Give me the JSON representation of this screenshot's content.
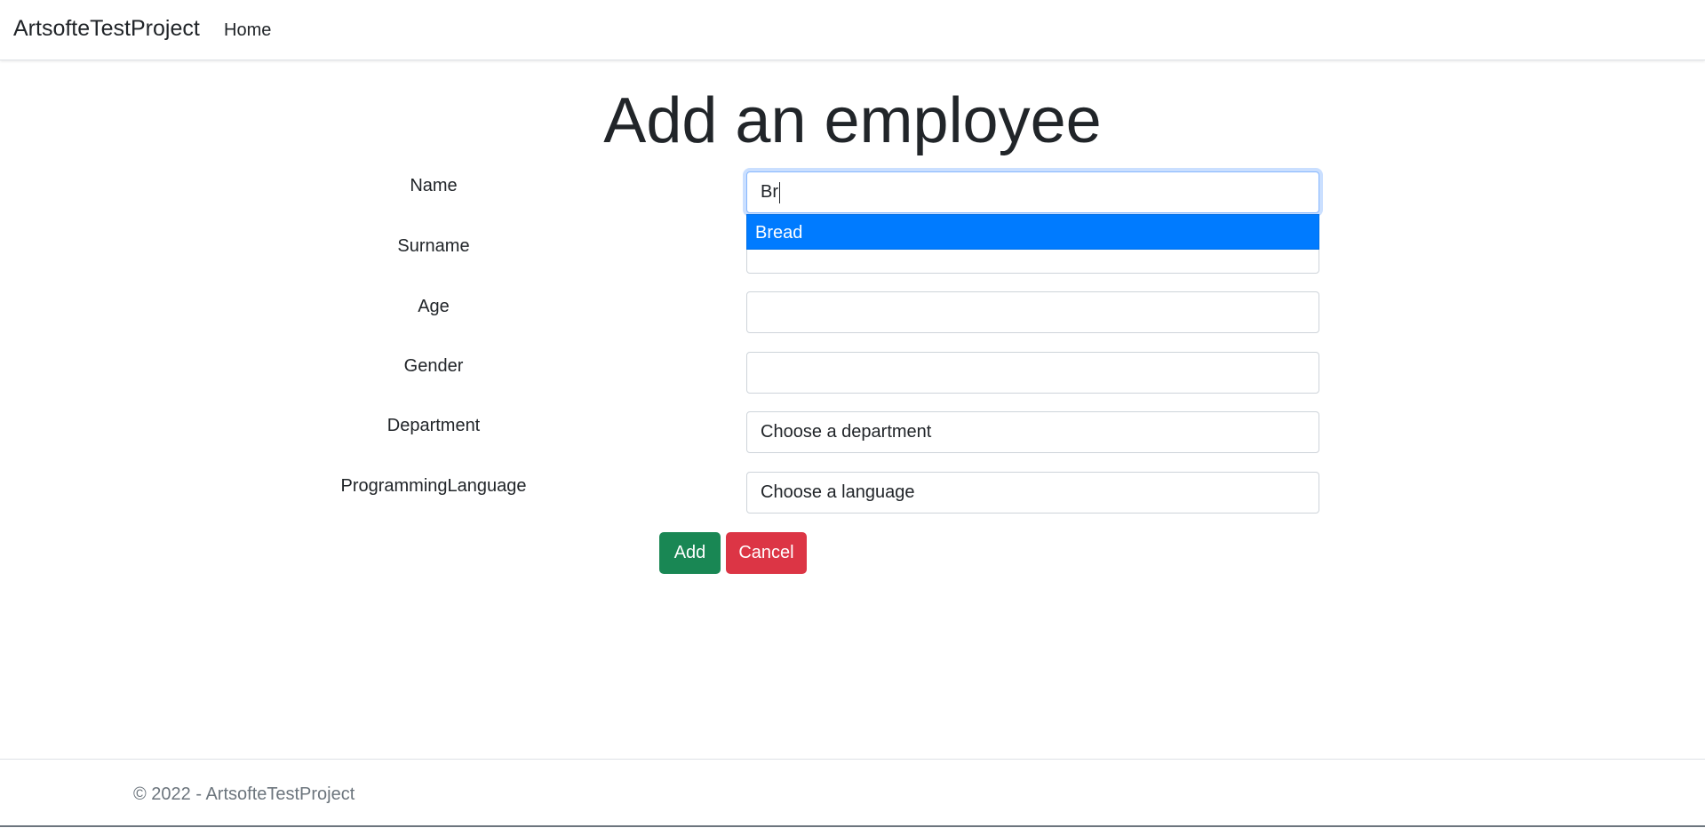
{
  "navbar": {
    "brand": "ArtsofteTestProject",
    "links": [
      {
        "label": "Home"
      }
    ]
  },
  "page": {
    "title": "Add an employee"
  },
  "form": {
    "fields": [
      {
        "label": "Name",
        "value": "Br",
        "placeholder": ""
      },
      {
        "label": "Surname",
        "value": "",
        "placeholder": ""
      },
      {
        "label": "Age",
        "value": "",
        "placeholder": ""
      },
      {
        "label": "Gender",
        "value": "",
        "placeholder": ""
      },
      {
        "label": "Department",
        "selected": "Choose a department"
      },
      {
        "label": "ProgrammingLanguage",
        "selected": "Choose a language"
      }
    ],
    "autocomplete": {
      "suggestions": [
        "Bread"
      ]
    },
    "buttons": {
      "add_label": "Add",
      "cancel_label": "Cancel"
    }
  },
  "footer": {
    "text": "© 2022 - ArtsofteTestProject"
  },
  "colors": {
    "add_button": "#198754",
    "cancel_button": "#dc3545",
    "autocomplete_highlight": "#007bff",
    "focus_border": "#86b7fe"
  }
}
